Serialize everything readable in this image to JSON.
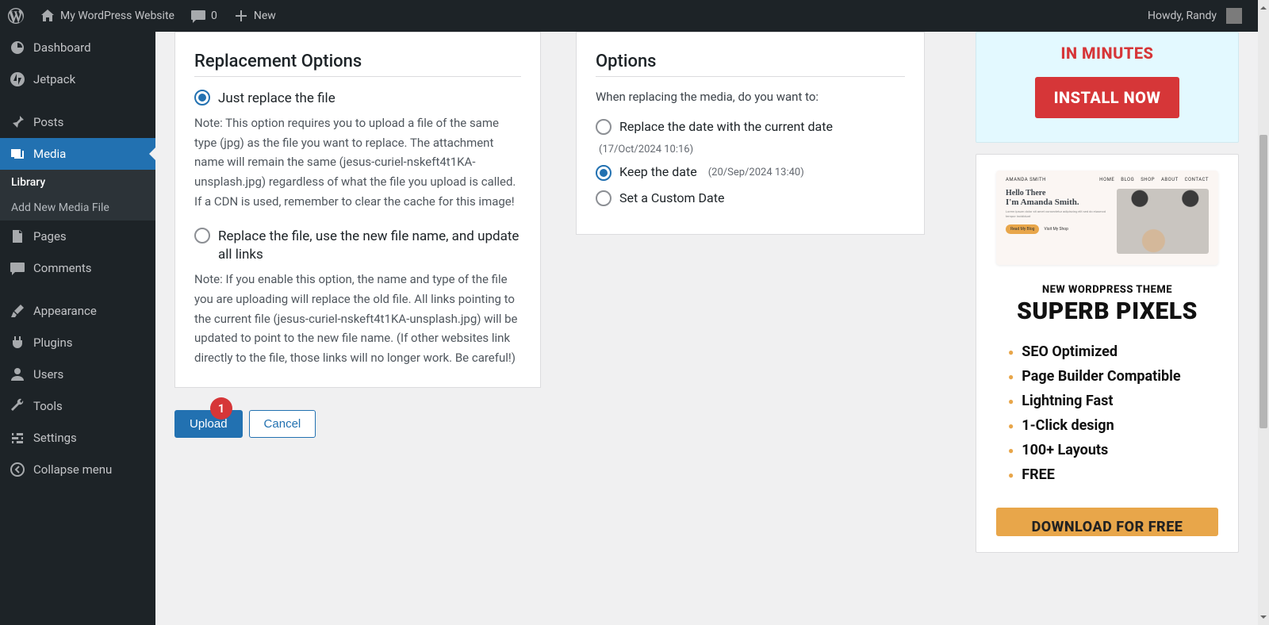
{
  "adminbar": {
    "site_name": "My WordPress Website",
    "comments_count": "0",
    "new_label": "New",
    "howdy": "Howdy, Randy"
  },
  "sidebar": {
    "items": [
      {
        "id": "dashboard",
        "label": "Dashboard"
      },
      {
        "id": "jetpack",
        "label": "Jetpack"
      },
      {
        "id": "posts",
        "label": "Posts"
      },
      {
        "id": "media",
        "label": "Media",
        "current": true
      },
      {
        "id": "pages",
        "label": "Pages"
      },
      {
        "id": "comments",
        "label": "Comments"
      },
      {
        "id": "appearance",
        "label": "Appearance"
      },
      {
        "id": "plugins",
        "label": "Plugins"
      },
      {
        "id": "users",
        "label": "Users"
      },
      {
        "id": "tools",
        "label": "Tools"
      },
      {
        "id": "settings",
        "label": "Settings"
      },
      {
        "id": "collapse",
        "label": "Collapse menu"
      }
    ],
    "media_submenu": [
      {
        "label": "Library",
        "current": true
      },
      {
        "label": "Add New Media File"
      }
    ]
  },
  "replacement": {
    "heading": "Replacement Options",
    "opt1_label": "Just replace the file",
    "opt1_note": "Note: This option requires you to upload a file of the same type (jpg) as the file you want to replace. The attachment name will remain the same (jesus-curiel-nskeft4t1KA-unsplash.jpg) regardless of what the file you upload is called. If a CDN is used, remember to clear the cache for this image!",
    "opt2_label": "Replace the file, use the new file name, and update all links",
    "opt2_note": "Note: If you enable this option, the name and type of the file you are uploading will replace the old file. All links pointing to the current file (jesus-curiel-nskeft4t1KA-unsplash.jpg) will be updated to point to the new file name. (If other websites link directly to the file, those links will no longer work. Be careful!)"
  },
  "options": {
    "heading": "Options",
    "intro": "When replacing the media, do you want to:",
    "opt1_label": "Replace the date with the current date",
    "opt1_hint": "(17/Oct/2024 10:16)",
    "opt2_label": "Keep the date",
    "opt2_hint": "(20/Sep/2024 13:40)",
    "opt3_label": "Set a Custom Date"
  },
  "buttons": {
    "upload": "Upload",
    "cancel": "Cancel",
    "badge": "1"
  },
  "promo1": {
    "headline": "IN MINUTES",
    "cta": "INSTALL NOW"
  },
  "promo2": {
    "preview": {
      "brand": "AMANDA SMITH",
      "nav": [
        "HOME",
        "BLOG",
        "SHOP",
        "ABOUT",
        "CONTACT"
      ],
      "line1": "Hello There",
      "line2": "I'm Amanda Smith.",
      "btn1": "Read My Blog",
      "btn2": "Visit My Shop"
    },
    "subhead": "NEW WORDPRESS THEME",
    "bighead": "SUPERB PIXELS",
    "bullets": [
      "SEO Optimized",
      "Page Builder Compatible",
      "Lightning Fast",
      "1-Click design",
      "100+ Layouts",
      "FREE"
    ],
    "dl": "DOWNLOAD FOR FREE"
  }
}
